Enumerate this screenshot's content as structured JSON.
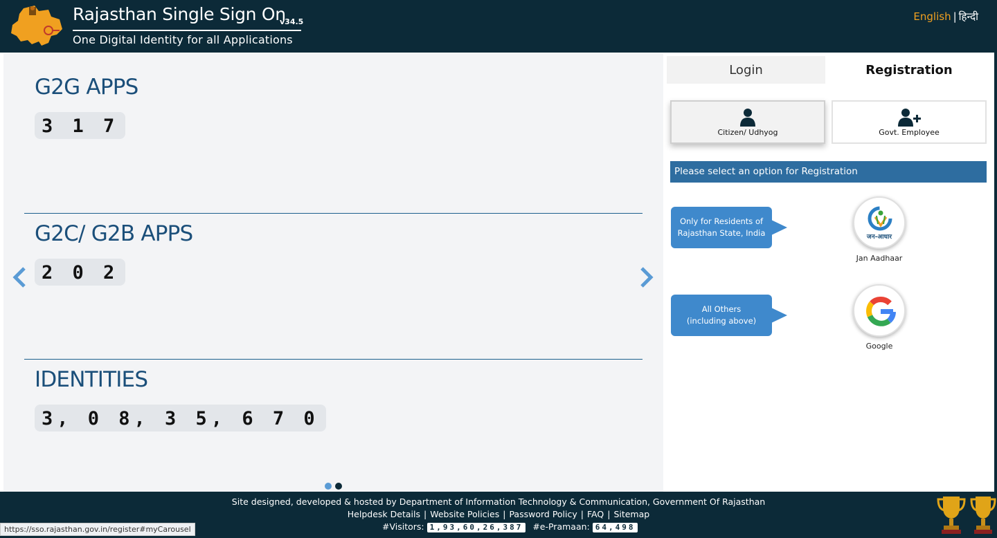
{
  "header": {
    "title": "Rajasthan Single Sign On",
    "version": "v34.5",
    "subtitle": "One Digital Identity for all Applications",
    "logo_text": "Rajasthan Single Sign On",
    "lang_english": "English",
    "lang_separator": "|",
    "lang_hindi": "हिन्दी"
  },
  "stats": [
    {
      "title": "G2G APPS",
      "value": "3 1 7"
    },
    {
      "title": "G2C/ G2B APPS",
      "value": "2 0 2"
    },
    {
      "title": "IDENTITIES",
      "value": "3, 0 8, 3 5, 6 7 0"
    }
  ],
  "carousel": {
    "active_index": 1,
    "total": 2
  },
  "tabs": {
    "login": "Login",
    "registration": "Registration",
    "active": "registration"
  },
  "options": {
    "citizen": "Citizen/ Udhyog",
    "govt": "Govt. Employee",
    "selected": "citizen"
  },
  "info_bar": "Please select an option for Registration",
  "registration_methods": [
    {
      "bubble_line1": "Only for Residents of",
      "bubble_line2": "Rajasthan State, India",
      "label": "Jan Aadhaar",
      "logo_text": "जन-आधार",
      "icon": "jan-aadhaar-logo"
    },
    {
      "bubble_line1": "All Others",
      "bubble_line2": "(including above)",
      "label": "Google",
      "icon": "google-logo"
    }
  ],
  "footer": {
    "credit": "Site designed, developed & hosted by Department of Information Technology & Communication, Government Of Rajasthan",
    "links": [
      "Helpdesk Details",
      "Website Policies",
      "Password Policy",
      "FAQ",
      "Sitemap"
    ],
    "visitors_label": "#Visitors:",
    "visitors_value": "1,93,60,26,387",
    "epramaan_label": "#e-Pramaan:",
    "epramaan_value": "64,498"
  },
  "status_url": "https://sso.rajasthan.gov.in/register#myCarousel",
  "colors": {
    "header_bg": "#0c2a38",
    "stat_title": "#1b4f7a",
    "info_bar": "#2e6da0",
    "bubble": "#3f89cc",
    "lang_active": "#f0a020"
  }
}
